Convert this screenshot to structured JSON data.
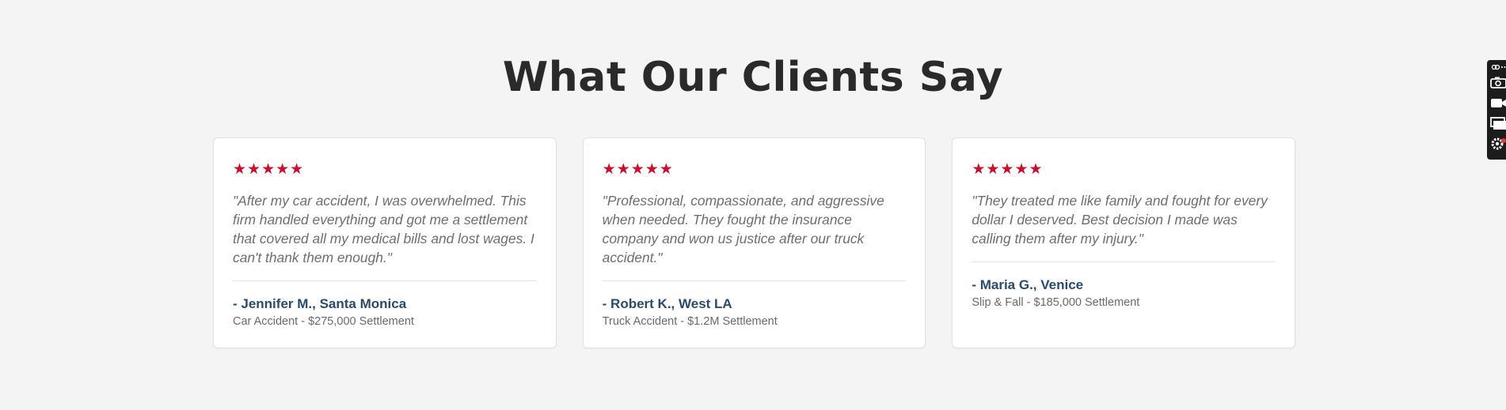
{
  "section": {
    "title": "What Our Clients Say"
  },
  "testimonials": [
    {
      "stars": "★★★★★",
      "quote": "\"After my car accident, I was overwhelmed. This firm handled everything and got me a settlement that covered all my medical bills and lost wages. I can't thank them enough.\"",
      "author": "- Jennifer M., Santa Monica",
      "detail": "Car Accident - $275,000 Settlement"
    },
    {
      "stars": "★★★★★",
      "quote": "\"Professional, compassionate, and aggressive when needed. They fought the insurance company and won us justice after our truck accident.\"",
      "author": "- Robert K., West LA",
      "detail": "Truck Accident - $1.2M Settlement"
    },
    {
      "stars": "★★★★★",
      "quote": "\"They treated me like family and fought for every dollar I deserved. Best decision I made was calling them after my injury.\"",
      "author": "- Maria G., Venice",
      "detail": "Slip & Fall - $185,000 Settlement"
    }
  ],
  "toolbar": {
    "icons": [
      "link-icon",
      "camera-icon",
      "video-icon",
      "window-icon",
      "settings-icon"
    ]
  },
  "colors": {
    "star": "#c8102e",
    "author": "#2b4a6f",
    "background": "#f4f4f4"
  }
}
